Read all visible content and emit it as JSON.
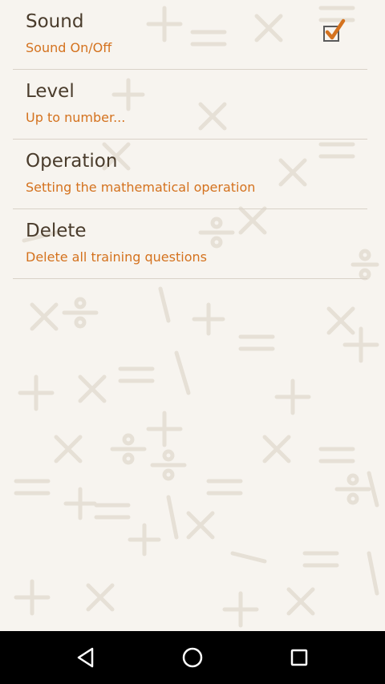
{
  "preferences": [
    {
      "title": "Sound",
      "summary": "Sound On/Off",
      "has_checkbox": true,
      "checked": true
    },
    {
      "title": "Level",
      "summary": "Up to number...",
      "has_checkbox": false
    },
    {
      "title": "Operation",
      "summary": "Setting the mathematical operation",
      "has_checkbox": false
    },
    {
      "title": "Delete",
      "summary": "Delete all training questions",
      "has_checkbox": false
    }
  ],
  "colors": {
    "title": "#4a3c2c",
    "summary": "#d4721e",
    "checkmark": "#d4721e",
    "background": "#f7f4ef",
    "pattern": "#ebe6de"
  },
  "navbar": {
    "icons": [
      "back-icon",
      "home-icon",
      "recents-icon"
    ]
  }
}
